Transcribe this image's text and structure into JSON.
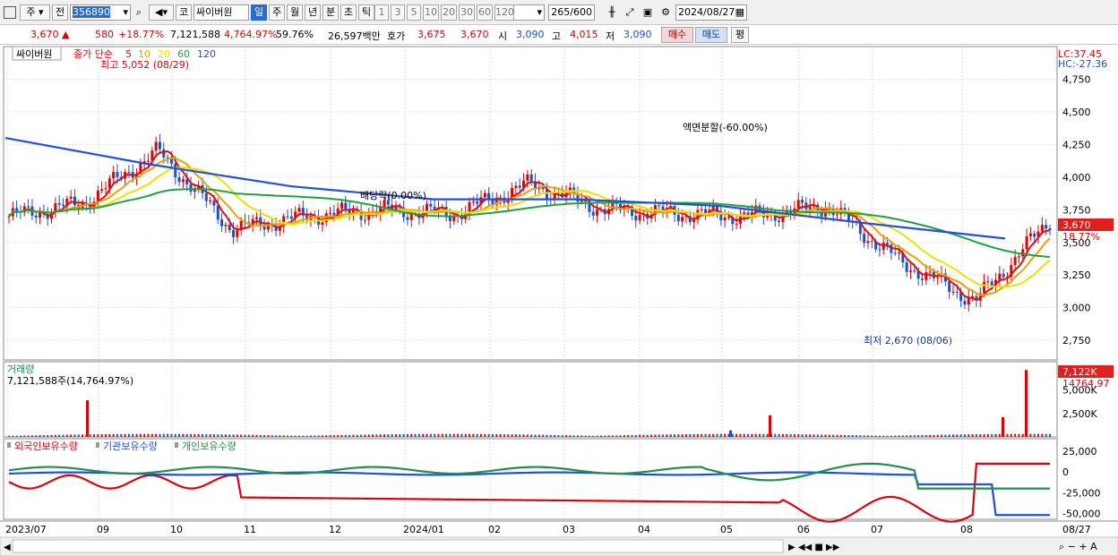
{
  "toolbar": {
    "market": "주",
    "prefix": "전",
    "code": "356890",
    "type_label": "코",
    "name": "싸이버원",
    "periods": [
      "일",
      "주",
      "월",
      "년",
      "분",
      "초",
      "틱"
    ],
    "active_period": "일",
    "intervals": [
      "1",
      "3",
      "5",
      "10",
      "20",
      "30",
      "60",
      "120"
    ],
    "count": "265",
    "count_total": "/600",
    "date": "2024/08/27"
  },
  "quote": {
    "price": "3,670",
    "change": "580",
    "change_pct": "+18.77%",
    "volume": "7,121,588",
    "volume_pct": "4,764.97%",
    "turnover_pct": "59.76%",
    "amount": "26,597백만",
    "ask_label": "호가",
    "ask": "3,675",
    "bid": "3,670",
    "open_label": "시",
    "open": "3,090",
    "high_label": "고",
    "high": "4,015",
    "low_label": "저",
    "low": "3,090",
    "buy": "매수",
    "sell": "매도",
    "eval": "평"
  },
  "price_panel": {
    "title": "싸이버원",
    "ma_label": "종가 단순",
    "ma_periods": [
      "5",
      "10",
      "20",
      "60",
      "120"
    ],
    "ma_colors": [
      "#e01010",
      "#f0a000",
      "#f0e000",
      "#20a040",
      "#2050e0"
    ],
    "max_note": "최고 5,052 (08/29)",
    "min_note": "최저 2,670 (08/06)",
    "split_note": "액면분할(-60.00%)",
    "div_note": "배당락(0.00%)",
    "lc": "LC:37.45",
    "hc": "HC:-27.36",
    "cur_price": "3,670",
    "cur_pct": "18.77%",
    "y_ticks": [
      "4,750",
      "4,500",
      "4,250",
      "4,000",
      "3,750",
      "3,500",
      "3,250",
      "3,000",
      "2,750"
    ]
  },
  "volume_panel": {
    "title": "거래량",
    "value_text": "7,121,588주(14,764.97%)",
    "cur": "7,122K",
    "cur_pct": "14764.97",
    "y_ticks": [
      "5,000K",
      "2,500K"
    ]
  },
  "holdings_panel": {
    "legend": [
      "외국인보유수량",
      "기관보유수량",
      "개인보유수량"
    ],
    "colors": [
      "#d8060c",
      "#2050e0",
      "#20904a"
    ],
    "y_ticks": [
      "25,000",
      "0",
      "-25,000",
      "-50,000"
    ]
  },
  "x_labels": [
    "2023/07",
    "09",
    "10",
    "11",
    "12",
    "2024/01",
    "02",
    "03",
    "04",
    "05",
    "06",
    "07",
    "08",
    "08/27"
  ],
  "chart_data": [
    {
      "type": "line",
      "title": "싸이버원 일봉",
      "series": [
        {
          "name": "종가",
          "x": [
            "2023/07",
            "2023/08",
            "2023/09",
            "2023/10",
            "2023/11",
            "2023/12",
            "2024/01",
            "2024/02",
            "2024/03",
            "2024/04",
            "2024/05",
            "2024/06",
            "2024/07",
            "2024/08",
            "08/27"
          ],
          "values": [
            3700,
            3800,
            4200,
            3600,
            3700,
            3750,
            3720,
            3950,
            3750,
            3720,
            3700,
            3780,
            3350,
            3050,
            3670
          ]
        },
        {
          "name": "120",
          "x": [
            "2023/07",
            "2023/09",
            "2023/10",
            "2023/12",
            "2024/02",
            "2024/05",
            "2024/07",
            "08/27"
          ],
          "values": [
            4300,
            4100,
            3930,
            3830,
            3830,
            3780,
            3650,
            3530
          ]
        }
      ],
      "ylim": [
        2600,
        5000
      ]
    },
    {
      "type": "bar",
      "title": "거래량",
      "series": [
        {
          "name": "거래량",
          "x": [
            "08/29",
            "2024/05",
            "2024/06",
            "2024/08",
            "08/27"
          ],
          "values": [
            3900,
            700,
            2300,
            2100,
            7122
          ]
        }
      ],
      "ylim": [
        0,
        8000
      ]
    }
  ]
}
